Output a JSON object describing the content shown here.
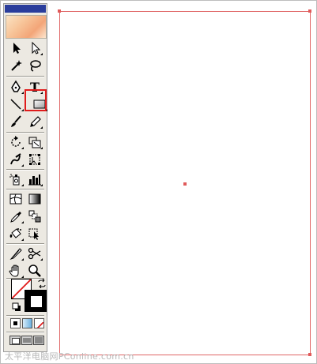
{
  "toolbox": {
    "tools": [
      {
        "name": "selection-tool",
        "icon": "arrow-icon"
      },
      {
        "name": "direct-selection-tool",
        "icon": "hollow-arrow-icon"
      },
      {
        "name": "magic-wand-tool",
        "icon": "magic-wand-icon"
      },
      {
        "name": "lasso-tool",
        "icon": "lasso-icon"
      },
      {
        "name": "pen-tool",
        "icon": "pen-icon"
      },
      {
        "name": "type-tool",
        "icon": "type-icon",
        "label": "T"
      },
      {
        "name": "line-segment-tool",
        "icon": "line-icon"
      },
      {
        "name": "rectangle-tool",
        "icon": "rectangle-icon",
        "active": true
      },
      {
        "name": "paintbrush-tool",
        "icon": "brush-icon"
      },
      {
        "name": "pencil-tool",
        "icon": "pencil-icon"
      },
      {
        "name": "rotate-tool",
        "icon": "rotate-icon"
      },
      {
        "name": "scale-tool",
        "icon": "scale-icon"
      },
      {
        "name": "warp-tool",
        "icon": "warp-icon"
      },
      {
        "name": "free-transform-tool",
        "icon": "free-transform-icon"
      },
      {
        "name": "symbol-sprayer-tool",
        "icon": "sprayer-icon"
      },
      {
        "name": "column-graph-tool",
        "icon": "graph-icon"
      },
      {
        "name": "mesh-tool",
        "icon": "mesh-icon"
      },
      {
        "name": "gradient-tool",
        "icon": "gradient-icon"
      },
      {
        "name": "eyedropper-tool",
        "icon": "eyedropper-icon"
      },
      {
        "name": "blend-tool",
        "icon": "blend-icon"
      },
      {
        "name": "live-paint-bucket-tool",
        "icon": "paint-bucket-icon"
      },
      {
        "name": "live-paint-selection-tool",
        "icon": "paint-select-icon"
      },
      {
        "name": "slice-tool",
        "icon": "slice-icon"
      },
      {
        "name": "scissors-tool",
        "icon": "scissors-icon"
      },
      {
        "name": "hand-tool",
        "icon": "hand-icon"
      },
      {
        "name": "zoom-tool",
        "icon": "zoom-icon"
      }
    ],
    "fill_color": "#ffffff",
    "stroke_color": "#000000",
    "accent": "#e01c1c"
  },
  "watermark": "太平洋电脑网PConline.com.cn"
}
